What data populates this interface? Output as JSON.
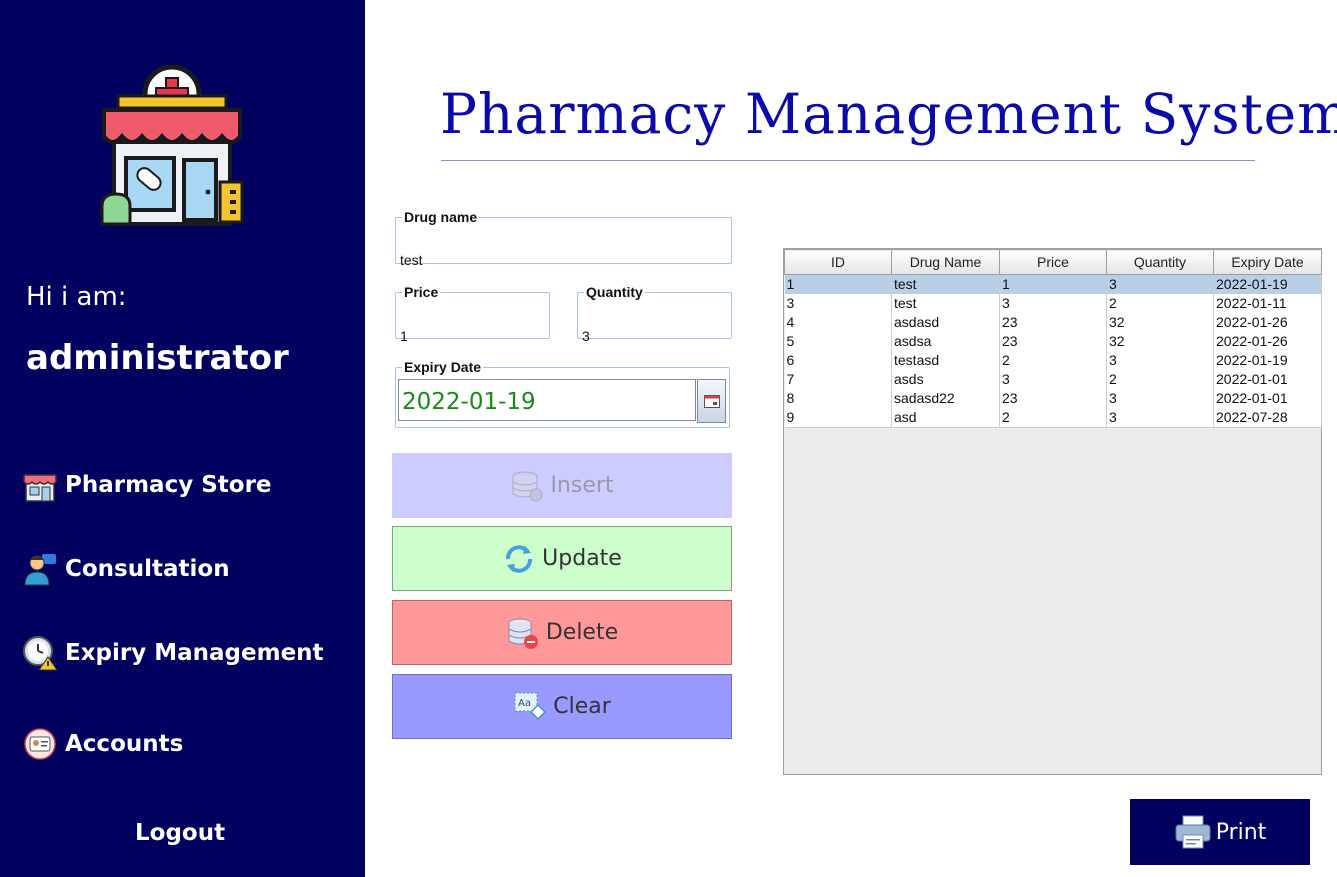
{
  "sidebar": {
    "greeting": "Hi i am:",
    "username": "administrator",
    "nav": [
      {
        "label": "Pharmacy Store",
        "icon": "store-icon"
      },
      {
        "label": "Consultation",
        "icon": "consultant-icon"
      },
      {
        "label": "Expiry Management",
        "icon": "clock-warning-icon"
      },
      {
        "label": "Accounts",
        "icon": "account-card-icon"
      }
    ],
    "logout": "Logout",
    "bg_color": "#02015f"
  },
  "header": {
    "title": "Pharmacy Management System"
  },
  "form": {
    "drug_name": {
      "label": "Drug name",
      "value": "test"
    },
    "price": {
      "label": "Price",
      "value": "1"
    },
    "quantity": {
      "label": "Quantity",
      "value": "3"
    },
    "expiry": {
      "label": "Expiry Date",
      "value": "2022-01-19"
    }
  },
  "buttons": {
    "insert": "Insert",
    "update": "Update",
    "delete": "Delete",
    "clear": "Clear",
    "print": "Print"
  },
  "table": {
    "columns": [
      "ID",
      "Drug Name",
      "Price",
      "Quantity",
      "Expiry Date"
    ],
    "rows": [
      [
        "1",
        "test",
        "1",
        "3",
        "2022-01-19"
      ],
      [
        "3",
        "test",
        "3",
        "2",
        "2022-01-11"
      ],
      [
        "4",
        "asdasd",
        "23",
        "32",
        "2022-01-26"
      ],
      [
        "5",
        "asdsa",
        "23",
        "32",
        "2022-01-26"
      ],
      [
        "6",
        "testasd",
        "2",
        "3",
        "2022-01-19"
      ],
      [
        "7",
        "asds",
        "3",
        "2",
        "2022-01-01"
      ],
      [
        "8",
        "sadasd22",
        "23",
        "3",
        "2022-01-01"
      ],
      [
        "9",
        "asd",
        "2",
        "3",
        "2022-07-28"
      ]
    ],
    "selected_row": 0
  }
}
